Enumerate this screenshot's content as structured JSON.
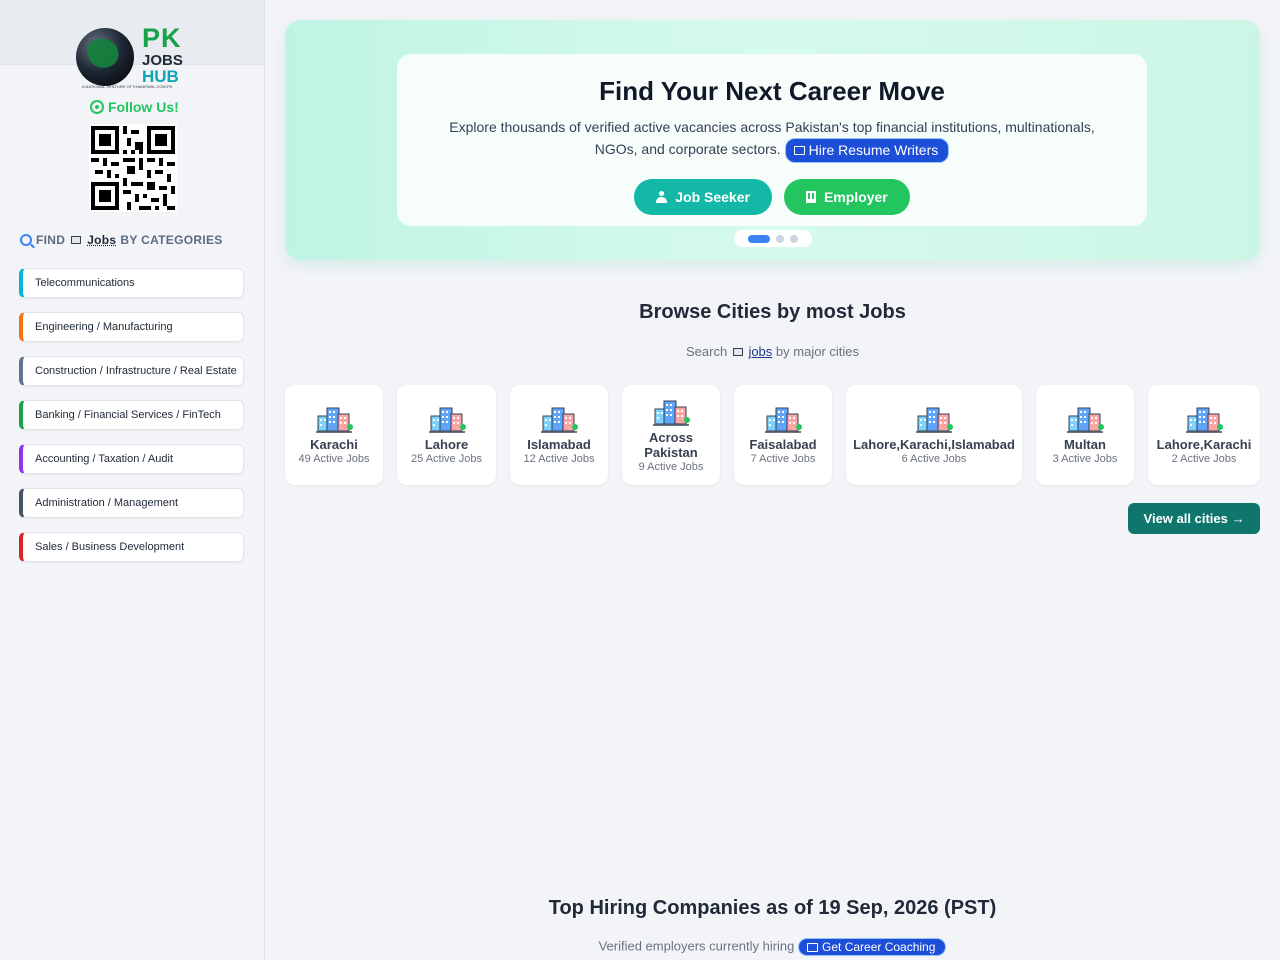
{
  "sidebar": {
    "logo": {
      "pk": "PK",
      "jobs": "JOBS",
      "hub": "HUB",
      "tagline": "A NATIONAL VENTURE OF KHANEWAL.COM.PK"
    },
    "follow_label": "Follow Us!",
    "categories_heading": {
      "prefix": "FIND",
      "link": "Jobs",
      "suffix": "BY CATEGORIES"
    },
    "categories": [
      {
        "label": "Telecommunications",
        "color": "#06b6d4"
      },
      {
        "label": "Engineering / Manufacturing",
        "color": "#f97316"
      },
      {
        "label": "Construction / Infrastructure / Real Estate",
        "color": "#64748b"
      },
      {
        "label": "Banking / Financial Services / FinTech",
        "color": "#16a34a"
      },
      {
        "label": "Accounting / Taxation / Audit",
        "color": "#9333ea"
      },
      {
        "label": "Administration / Management",
        "color": "#475569"
      },
      {
        "label": "Sales / Business Development",
        "color": "#dc2626"
      }
    ]
  },
  "hero": {
    "title": "Find Your Next Career Move",
    "description": "Explore thousands of verified active vacancies across Pakistan's top financial institutions, multinationals, NGOs, and corporate sectors.",
    "hire_pill": "Hire Resume Writers",
    "job_seeker_btn": "Job Seeker",
    "employer_btn": "Employer"
  },
  "cities_section": {
    "title": "Browse Cities by most Jobs",
    "sub_prefix": "Search",
    "sub_link": "jobs",
    "sub_suffix": "by major cities",
    "cities": [
      {
        "name": "Karachi",
        "count": "49 Active Jobs"
      },
      {
        "name": "Lahore",
        "count": "25 Active Jobs"
      },
      {
        "name": "Islamabad",
        "count": "12 Active Jobs"
      },
      {
        "name": "Across Pakistan",
        "count": "9 Active Jobs"
      },
      {
        "name": "Faisalabad",
        "count": "7 Active Jobs"
      },
      {
        "name": "Lahore,Karachi,Islamabad",
        "count": "6 Active Jobs"
      },
      {
        "name": "Multan",
        "count": "3 Active Jobs"
      },
      {
        "name": "Lahore,Karachi",
        "count": "2 Active Jobs"
      }
    ],
    "view_all": "View all cities →"
  },
  "companies_section": {
    "title": "Top Hiring Companies as of 19 Sep, 2026 (PST)",
    "sub": "Verified employers currently hiring",
    "coaching_pill": "Get Career Coaching"
  }
}
